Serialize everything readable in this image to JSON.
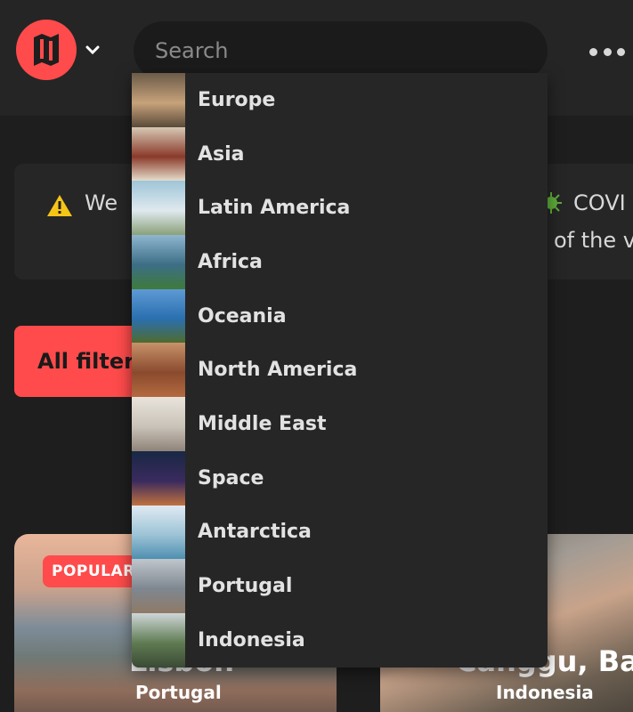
{
  "header": {
    "search_placeholder": "Search",
    "accent": "#ff4b4b"
  },
  "notice": {
    "left_text": "We",
    "right_line1": "COVI",
    "right_line2": "of the v"
  },
  "filters": {
    "label": "All filter"
  },
  "dropdown": {
    "items": [
      {
        "label": "Europe",
        "thumb": [
          "#6b5a48",
          "#c7a27a",
          "#5a4a3a"
        ]
      },
      {
        "label": "Asia",
        "thumb": [
          "#d6c8b4",
          "#8a3a2a",
          "#e6dccb"
        ]
      },
      {
        "label": "Latin America",
        "thumb": [
          "#9fc5d8",
          "#dfe9ee",
          "#8aa07a"
        ]
      },
      {
        "label": "Africa",
        "thumb": [
          "#8fb6d0",
          "#3c6e86",
          "#3f7a3a"
        ]
      },
      {
        "label": "Oceania",
        "thumb": [
          "#5e9ad4",
          "#2a6fb0",
          "#4f6b2e"
        ]
      },
      {
        "label": "North America",
        "thumb": [
          "#c7926a",
          "#8a4a2e",
          "#b36a3f"
        ]
      },
      {
        "label": "Middle East",
        "thumb": [
          "#e8e3dc",
          "#c9c2b8",
          "#8f8378"
        ]
      },
      {
        "label": "Space",
        "thumb": [
          "#182844",
          "#3a2a5e",
          "#c0723e"
        ]
      },
      {
        "label": "Antarctica",
        "thumb": [
          "#dfeaf2",
          "#9cc3d6",
          "#4e8fb0"
        ]
      },
      {
        "label": "Portugal",
        "thumb": [
          "#c0c6cc",
          "#7e8790",
          "#8f7a66"
        ]
      },
      {
        "label": "Indonesia",
        "thumb": [
          "#cfd6d8",
          "#5f7b52",
          "#3a4a34"
        ]
      }
    ]
  },
  "cards": [
    {
      "badge": "POPULAR",
      "title": "Lisbon",
      "subtitle": "Portugal"
    },
    {
      "title": "Canggu, Bali",
      "subtitle": "Indonesia"
    }
  ]
}
